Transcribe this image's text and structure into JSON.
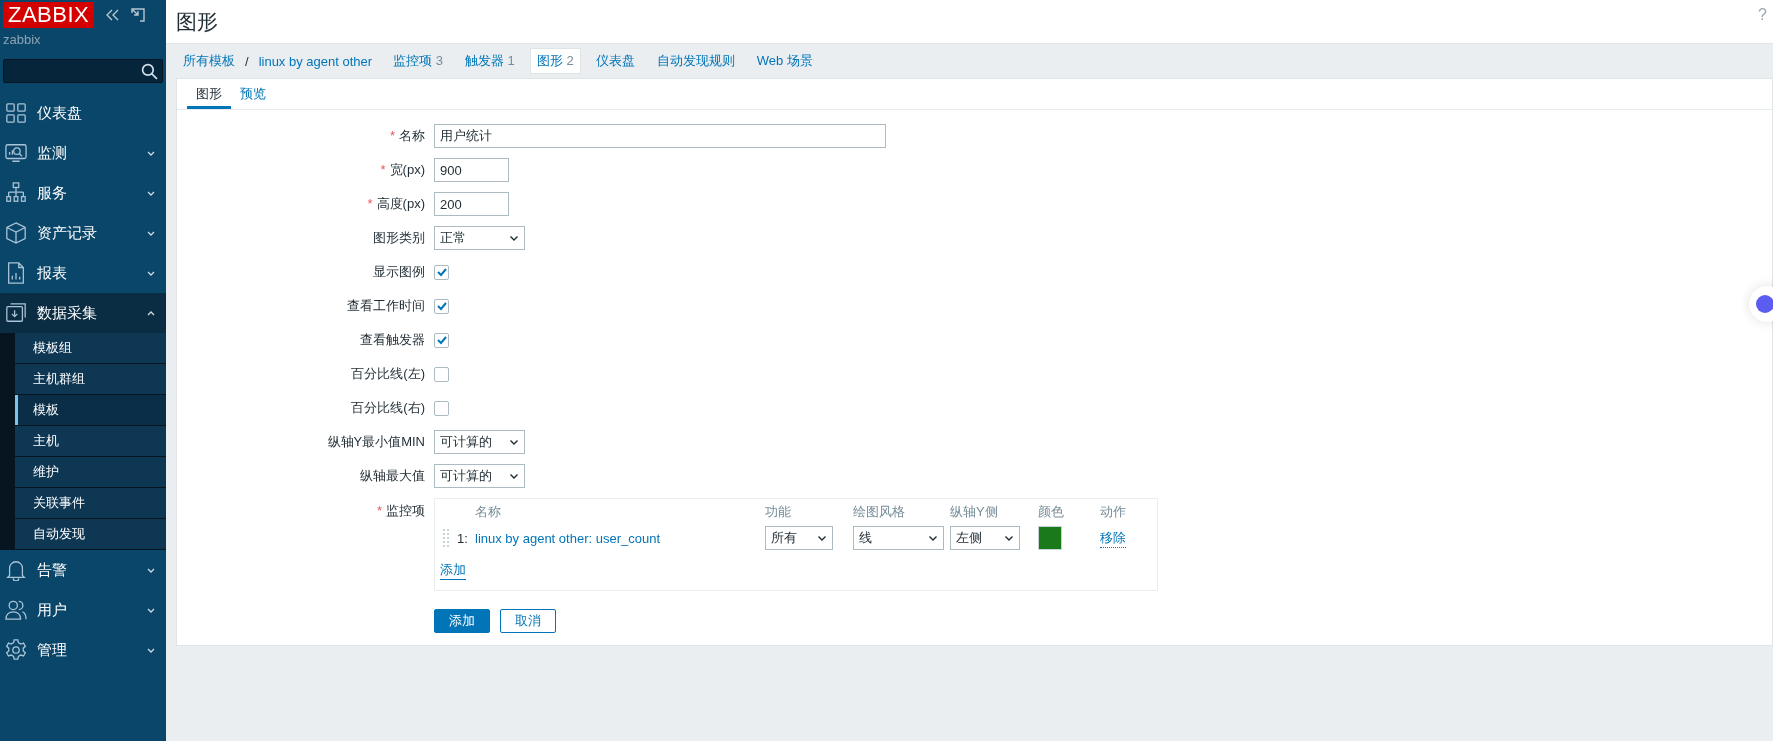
{
  "sidebar": {
    "logo": "ZABBIX",
    "server": "zabbix",
    "menu": [
      {
        "label": "仪表盘",
        "kind": "link"
      },
      {
        "label": "监测",
        "kind": "group",
        "expanded": false
      },
      {
        "label": "服务",
        "kind": "group",
        "expanded": false
      },
      {
        "label": "资产记录",
        "kind": "group",
        "expanded": false
      },
      {
        "label": "报表",
        "kind": "group",
        "expanded": false
      },
      {
        "label": "数据采集",
        "kind": "group",
        "expanded": true,
        "children": [
          {
            "label": "模板组",
            "selected": false
          },
          {
            "label": "主机群组",
            "selected": false
          },
          {
            "label": "模板",
            "selected": true
          },
          {
            "label": "主机",
            "selected": false
          },
          {
            "label": "维护",
            "selected": false
          },
          {
            "label": "关联事件",
            "selected": false
          },
          {
            "label": "自动发现",
            "selected": false
          }
        ]
      },
      {
        "label": "告警",
        "kind": "group",
        "expanded": false
      },
      {
        "label": "用户",
        "kind": "group",
        "expanded": false
      },
      {
        "label": "管理",
        "kind": "group",
        "expanded": false
      }
    ]
  },
  "header": {
    "title": "图形",
    "help": "?"
  },
  "breadcrumb": [
    {
      "label": "所有模板"
    },
    {
      "label": "linux by agent other"
    }
  ],
  "breadcrumb_separator": "/",
  "tabs": [
    {
      "label": "监控项",
      "count": "3",
      "selected": false
    },
    {
      "label": "触发器",
      "count": "1",
      "selected": false
    },
    {
      "label": "图形",
      "count": "2",
      "selected": true
    },
    {
      "label": "仪表盘",
      "selected": false
    },
    {
      "label": "自动发现规则",
      "selected": false
    },
    {
      "label": "Web 场景",
      "selected": false
    }
  ],
  "subtabs": [
    {
      "label": "图形",
      "selected": true
    },
    {
      "label": "预览",
      "selected": false
    }
  ],
  "form": [
    {
      "required_mark": "*",
      "label": "名称",
      "kind": "longtext",
      "value": "用户统计"
    },
    {
      "required_mark": "*",
      "label": "宽(px)",
      "kind": "text",
      "value": "900"
    },
    {
      "required_mark": "*",
      "label": "高度(px)",
      "kind": "text",
      "value": "200"
    },
    {
      "label": "图形类别",
      "kind": "select",
      "value": "正常"
    },
    {
      "label": "显示图例",
      "kind": "checkbox",
      "checked": true
    },
    {
      "label": "查看工作时间",
      "kind": "checkbox",
      "checked": true
    },
    {
      "label": "查看触发器",
      "kind": "checkbox",
      "checked": true
    },
    {
      "label": "百分比线(左)",
      "kind": "checkbox",
      "checked": false
    },
    {
      "label": "百分比线(右)",
      "kind": "checkbox",
      "checked": false
    },
    {
      "label": "纵轴Y最小值MIN",
      "kind": "select",
      "value": "可计算的"
    },
    {
      "label": "纵轴最大值",
      "kind": "select",
      "value": "可计算的"
    }
  ],
  "items": {
    "required_mark": "*",
    "label": "监控项",
    "columns": [
      "名称",
      "功能",
      "绘图风格",
      "纵轴Y侧",
      "颜色",
      "动作"
    ],
    "rows": [
      {
        "index": "1:",
        "name": "linux by agent other: user_count",
        "function": "所有",
        "style": "线",
        "side": "左侧",
        "color": "#1a7a1a",
        "action": "移除"
      }
    ],
    "add_link": "添加"
  },
  "buttons": [
    {
      "label": "添加",
      "kind": "primary"
    },
    {
      "label": "取消",
      "kind": "secondary"
    }
  ]
}
